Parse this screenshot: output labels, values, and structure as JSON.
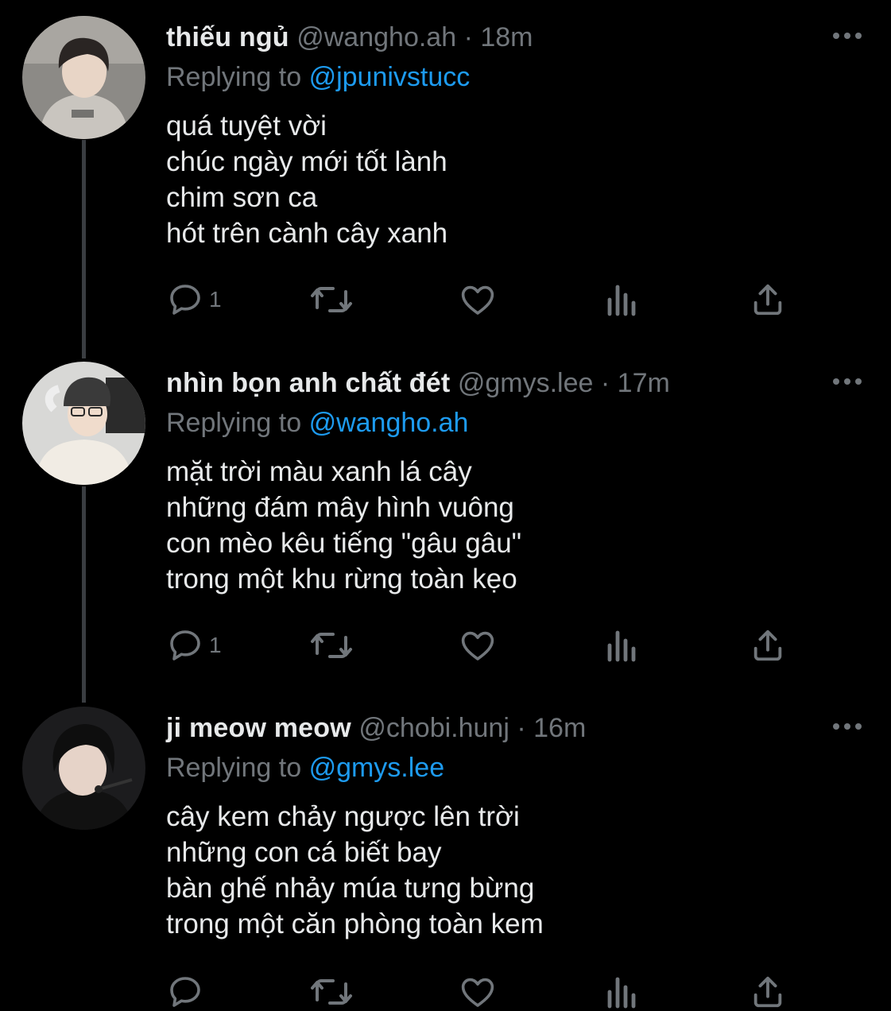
{
  "replies": [
    {
      "display_name": "thiếu ngủ",
      "handle": "@wangho.ah",
      "separator": "·",
      "time": "18m",
      "replying_prefix": "Replying to",
      "replying_to": "@jpunivstucc",
      "lines": [
        "quá tuyệt vời",
        "chúc ngày mới tốt lành",
        "chim sơn ca",
        "hót trên cành cây xanh"
      ],
      "reply_count": "1",
      "avatar_icon": "user-avatar"
    },
    {
      "display_name": "nhìn bọn anh chất đét",
      "handle": "@gmys.lee",
      "separator": "·",
      "time": "17m",
      "replying_prefix": "Replying to",
      "replying_to": "@wangho.ah",
      "lines": [
        "mặt trời màu xanh lá cây",
        "những đám mây hình vuông",
        "con mèo kêu tiếng \"gâu gâu\"",
        "trong một khu rừng toàn kẹo"
      ],
      "reply_count": "1",
      "avatar_icon": "user-avatar"
    },
    {
      "display_name": "ji meow meow",
      "handle": "@chobi.hunj",
      "separator": "·",
      "time": "16m",
      "replying_prefix": "Replying to",
      "replying_to": "@gmys.lee",
      "lines": [
        "cây kem chảy ngược lên trời",
        "những con cá biết bay",
        "bàn ghế nhảy múa tưng bừng",
        "trong một căn phòng toàn kem"
      ],
      "reply_count": "",
      "avatar_icon": "user-avatar"
    }
  ],
  "icons": {
    "reply": "reply-icon",
    "retweet": "retweet-icon",
    "like": "like-icon",
    "views": "views-icon",
    "share": "share-icon",
    "more": "more-icon"
  },
  "colors": {
    "background": "#000000",
    "text": "#e7e9ea",
    "secondary": "#71767b",
    "accent": "#1d9bf0",
    "thread_line": "#3a3d41"
  }
}
